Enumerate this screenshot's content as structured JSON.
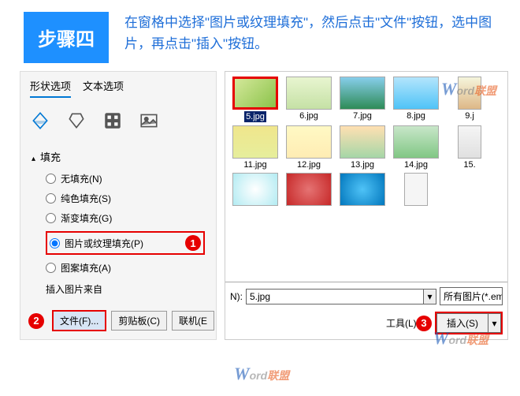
{
  "header": {
    "step_label": "步骤四",
    "instruction": "在窗格中选择\"图片或纹理填充\"，然后点击\"文件\"按钮，选中图片，再点击\"插入\"按钮。"
  },
  "sidebar": {
    "tab_shape": "形状选项",
    "tab_text": "文本选项",
    "fill_header": "填充",
    "radios": {
      "none": "无填充(N)",
      "solid": "纯色填充(S)",
      "gradient": "渐变填充(G)",
      "picture": "图片或纹理填充(P)",
      "pattern": "图案填充(A)"
    },
    "insert_from": "插入图片来自",
    "buttons": {
      "file": "文件(F)...",
      "clipboard": "剪贴板(C)",
      "online": "联机(E"
    }
  },
  "badges": {
    "one": "1",
    "two": "2",
    "three": "3"
  },
  "browser": {
    "thumbs": [
      {
        "label": "5.jpg",
        "selected": true,
        "bg": "linear-gradient(135deg,#d4e89a,#8bc34a)"
      },
      {
        "label": "6.jpg",
        "bg": "linear-gradient(#e8f5d0,#c5e1a5)"
      },
      {
        "label": "7.jpg",
        "bg": "linear-gradient(#87ceeb,#2e8b57)"
      },
      {
        "label": "8.jpg",
        "bg": "linear-gradient(#b3e5fc,#4fc3f7)"
      },
      {
        "label": "9.j",
        "bg": "linear-gradient(#f5f5dc,#deb887)",
        "partial": true
      },
      {
        "label": "11.jpg",
        "bg": "linear-gradient(#f0e68c,#e6ee9c)"
      },
      {
        "label": "12.jpg",
        "bg": "linear-gradient(#fff9c4,#ffecb3)"
      },
      {
        "label": "13.jpg",
        "bg": "linear-gradient(#ffe0b2,#a5d6a7)"
      },
      {
        "label": "14.jpg",
        "bg": "linear-gradient(#c8e6c9,#81c784)"
      },
      {
        "label": "15.",
        "bg": "linear-gradient(#f5f5f5,#e0e0e0)",
        "partial": true
      },
      {
        "label": "",
        "bg": "radial-gradient(circle,#fff,#b2ebf2)"
      },
      {
        "label": "",
        "bg": "radial-gradient(circle,#e57373,#c62828)"
      },
      {
        "label": "",
        "bg": "radial-gradient(circle,#4fc3f7,#0277bd)"
      },
      {
        "label": "",
        "bg": "#f5f5f5",
        "partial": true
      }
    ],
    "filename_label": "N):",
    "filename_value": "5.jpg",
    "filter": "所有图片(*.em",
    "tools_label": "工具(L)",
    "insert_btn": "插入(S)"
  },
  "watermark": {
    "w": "W",
    "ord": "ord",
    "cn": "联盟"
  }
}
